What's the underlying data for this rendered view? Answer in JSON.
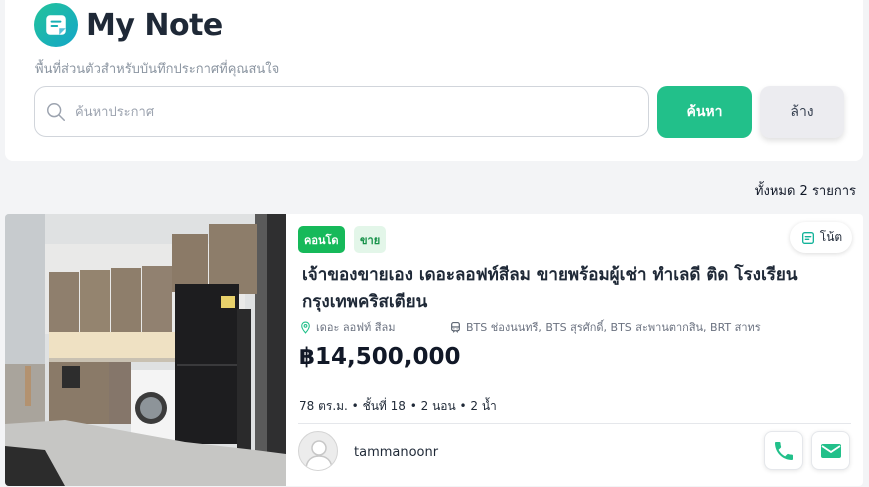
{
  "header": {
    "logo_icon": "note-icon",
    "title": "My Note",
    "subtitle": "พื้นที่ส่วนตัวสำหรับบันทึกประกาศที่คุณสนใจ"
  },
  "search": {
    "placeholder": "ค้นหาประกาศ",
    "value": "",
    "submit_label": "ค้นหา",
    "clear_label": "ล้าง"
  },
  "results": {
    "total_label": "ทั้งหมด 2 รายการ"
  },
  "listing": {
    "type_badge": "คอนโด",
    "deal_badge": "ขาย",
    "note_label": "โน้ต",
    "title": "เจ้าของขายเอง เดอะลอฟท์สีลม ขายพร้อมผู้เช่า ทำเลดี ติด โรงเรียนกรุงเทพคริสเตียน",
    "location": "เดอะ ลอฟท์ สีลม",
    "transit": "BTS ช่องนนทรี, BTS สุรศักดิ์, BTS สะพานตากสิน, BRT สาทร",
    "price": "฿14,500,000",
    "specs": "78 ตร.ม. • ชั้นที่ 18 • 2 นอน • 2 น้ำ",
    "owner_name": "tammanoonr"
  },
  "colors": {
    "accent": "#22c08a",
    "badge_green": "#16b95a",
    "badge_light": "#e3f6e9",
    "logo_gradient_start": "#22c39a",
    "logo_gradient_end": "#14a6c9"
  },
  "icons": {
    "search": "search-icon",
    "note": "note-icon",
    "location": "location-pin-icon",
    "transit": "train-icon",
    "phone": "phone-icon",
    "mail": "mail-icon",
    "avatar": "user-avatar-icon"
  }
}
